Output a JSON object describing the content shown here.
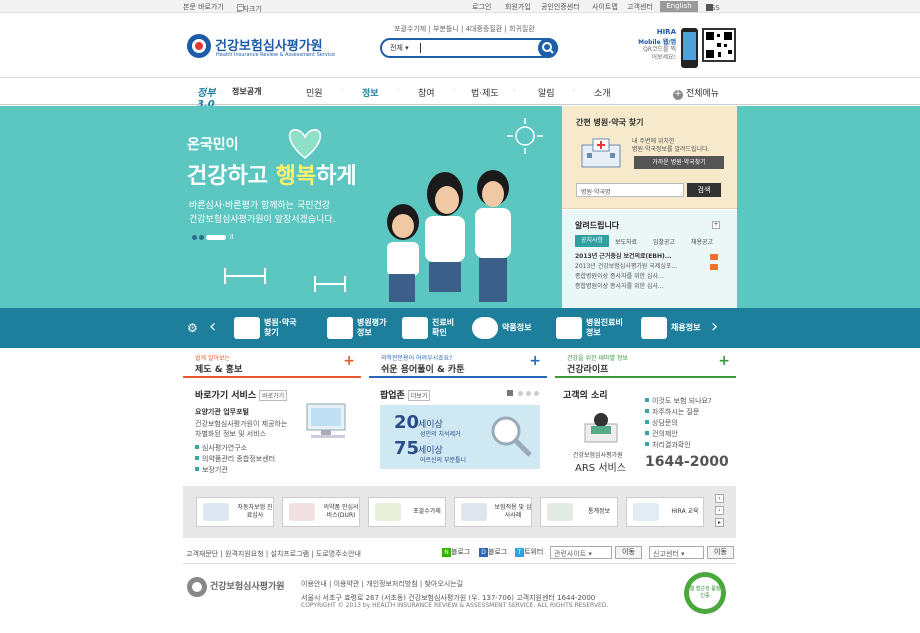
{
  "topbar": {
    "skip": "본문 바로가기",
    "fontsize": "글자크기",
    "login": "로그인",
    "join": "회원가입",
    "cert": "공인인증센터",
    "sitemap": "사이트맵",
    "customer": "고객센터",
    "english": "English",
    "rss": "RSS"
  },
  "header": {
    "logo_ko": "건강보험심사평가원",
    "logo_en": "Health Insurance Review & Assessment Service",
    "quicklinks": "포괄수가제 | 부분틀니 | 4대중증질환 | 희귀질환",
    "search_select": "전체",
    "mobile_title": "HIRA",
    "mobile_sub": "Mobile 웹/앱",
    "mobile_qr": "QR코드를 찍어보세요!"
  },
  "gnb": {
    "badge": "정보공개",
    "items": [
      "민원",
      "정보",
      "참여",
      "법·제도",
      "알림",
      "소개"
    ],
    "all_menu": "전체메뉴"
  },
  "hero": {
    "title1": "온국민이",
    "title2a": "건강하고",
    "title2b": "행복",
    "title2c": "하게",
    "body1": "바른심사·바른평가 함께하는 국민건강",
    "body2": "건강보험심사평가원이 앞장서겠습니다."
  },
  "find": {
    "title": "간편 병원·약국 찾기",
    "desc1": "내 주변에 위치한",
    "desc2": "병원·약국정보를 알려드립니다.",
    "nearby_btn": "가까운 병원·약국찾기",
    "input_placeholder": "병원·약국명",
    "search_btn": "검색"
  },
  "notice": {
    "title": "알려드립니다",
    "tabs": [
      "공지사항",
      "보도자료",
      "입찰공고",
      "채용공고"
    ],
    "items": [
      "2013년 근거중심 보건의료(EBH)...",
      "2013년 건강보험심사평가원 국제심포...",
      "종합병원이상 종사자를 위한 심사...",
      "종합병원이상 종사자를 위한 심사..."
    ]
  },
  "quickmenu": [
    {
      "label1": "병원·약국",
      "label2": "찾기"
    },
    {
      "label1": "병원평가",
      "label2": "정보"
    },
    {
      "label1": "진료비",
      "label2": "확인"
    },
    {
      "label1": "약품정보",
      "label2": ""
    },
    {
      "label1": "병원진료비",
      "label2": "정보"
    },
    {
      "label1": "채용정보",
      "label2": ""
    }
  ],
  "themes": [
    {
      "small": "쉽게 알아보는",
      "big": "제도 & 홍보",
      "color": "#e85a2c"
    },
    {
      "small": "의학전문용어 어려우시죠요?",
      "big": "쉬운 용어풀이 & 카툰",
      "color": "#2a67b8"
    },
    {
      "small": "건강을 위한 테마별 정보",
      "big": "건강라이프",
      "color": "#3a9a3c"
    }
  ],
  "shortcut": {
    "title": "바로가기 서비스",
    "tag": "바로가기",
    "sub": "요양기관 업무포털",
    "desc1": "건강보험심사평가원이 제공하는",
    "desc2": "차별화된 정보 및 서비스",
    "items": [
      "심사평가연구소",
      "의약품관리 종합정보센터",
      "보장기관"
    ]
  },
  "popup": {
    "title": "팝업존",
    "tag": "더보기",
    "age1": "20",
    "age1_txt": "세이상",
    "age2": "75",
    "age2_txt": "세이상",
    "sub1": "성인의 치석제거",
    "sub2": "어르신의 부분틀니"
  },
  "voice": {
    "title": "고객의 소리",
    "items": [
      "이것도 보험 되나요?",
      "자주하시는 질문",
      "상담문의",
      "건의제안",
      "처리결과확인"
    ],
    "ars_org": "건강보험심사평가원",
    "ars": "ARS 서비스",
    "phone": "1644-2000"
  },
  "banners": [
    "자동차보험 진료심사",
    "의약품 안심서비스(DUR)",
    "포괄수가제",
    "보험적용 및 심사사례",
    "통계정보",
    "HIRA 교육"
  ],
  "footnav": {
    "links": "고객재문단 | 원격지원요청 | 설치프로그램 | 도로명주소안내",
    "blog": "블로그",
    "blog2": "블로그",
    "twitter": "트위터",
    "related": "관련사이트",
    "go": "이동",
    "center": "신고센터",
    "go2": "이동"
  },
  "footer": {
    "links": "이용안내 | 이용약관 | 개인정보처리방침 | 찾아오시는길",
    "address": "서울시 서초구 효령로 267 (서초동) 건강보험심사평가원 (우. 137-706) 고객지원센터 1644-2000",
    "copyright": "COPYRIGHT © 2013 by HEALTH INSURANCE REVIEW & ASSESSMENT SERVICE. ALL RIGHTS RESERVED.",
    "logo": "건강보험심사평가원",
    "badge": "웹 접근성 품질인증"
  },
  "colors": {
    "brand": "#1d5aa8",
    "teal": "#5cc6c0",
    "quick": "#1d7f9c"
  }
}
